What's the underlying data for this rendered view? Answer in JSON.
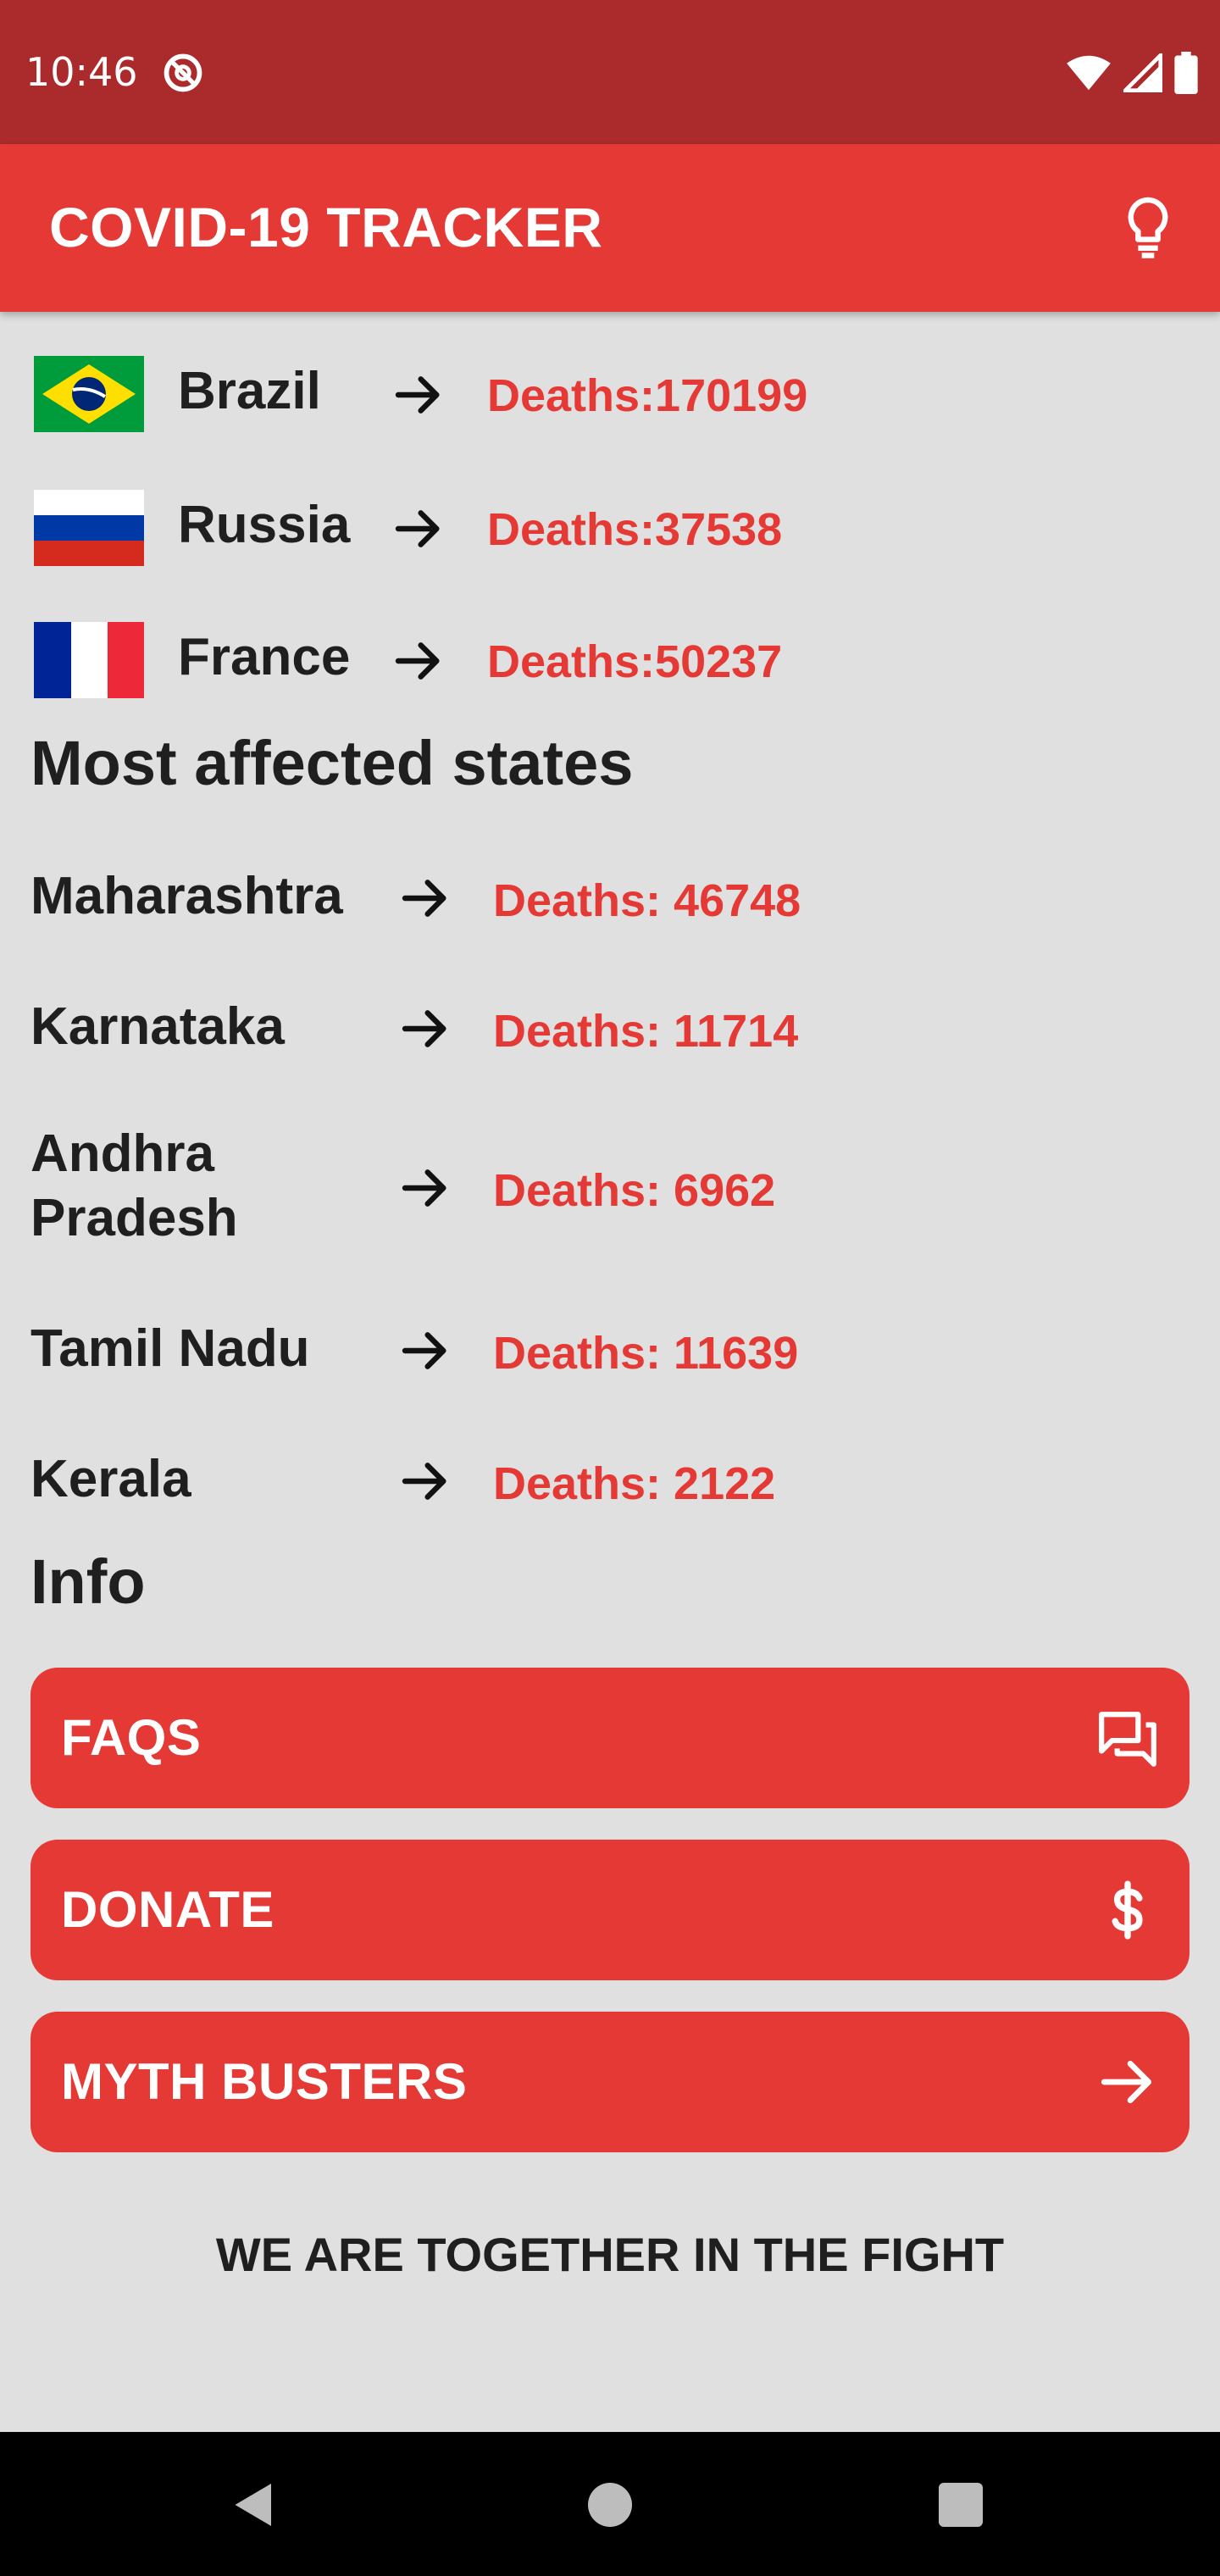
{
  "status_bar": {
    "time": "10:46",
    "icons": [
      "sync-icon",
      "wifi-icon",
      "signal-icon",
      "battery-icon"
    ]
  },
  "app_bar": {
    "title": "COVID-19 TRACKER",
    "action_icon": "lightbulb-icon"
  },
  "countries": [
    {
      "name": "Brazil",
      "deaths": "Deaths:170199",
      "flag": "brazil-flag"
    },
    {
      "name": "Russia",
      "deaths": "Deaths:37538",
      "flag": "russia-flag"
    },
    {
      "name": "France",
      "deaths": "Deaths:50237",
      "flag": "france-flag"
    }
  ],
  "states_section": {
    "title": "Most affected states",
    "states": [
      {
        "name": "Maharashtra",
        "deaths": "Deaths: 46748"
      },
      {
        "name": "Karnataka",
        "deaths": "Deaths: 11714"
      },
      {
        "name": "Andhra Pradesh",
        "deaths": "Deaths: 6962"
      },
      {
        "name": "Tamil Nadu",
        "deaths": "Deaths: 11639"
      },
      {
        "name": "Kerala",
        "deaths": "Deaths: 2122"
      }
    ]
  },
  "info_section": {
    "title": "Info",
    "buttons": [
      {
        "label": "FAQS",
        "icon": "forum-icon"
      },
      {
        "label": "DONATE",
        "icon": "dollar-icon"
      },
      {
        "label": "MYTH BUSTERS",
        "icon": "arrow-right-icon"
      }
    ]
  },
  "footer": {
    "text": "WE ARE TOGETHER IN THE FIGHT"
  },
  "colors": {
    "status_bar": "#ab2a2b",
    "accent": "#e53935",
    "background": "#e0e0e0",
    "text": "#1f1f1f"
  }
}
